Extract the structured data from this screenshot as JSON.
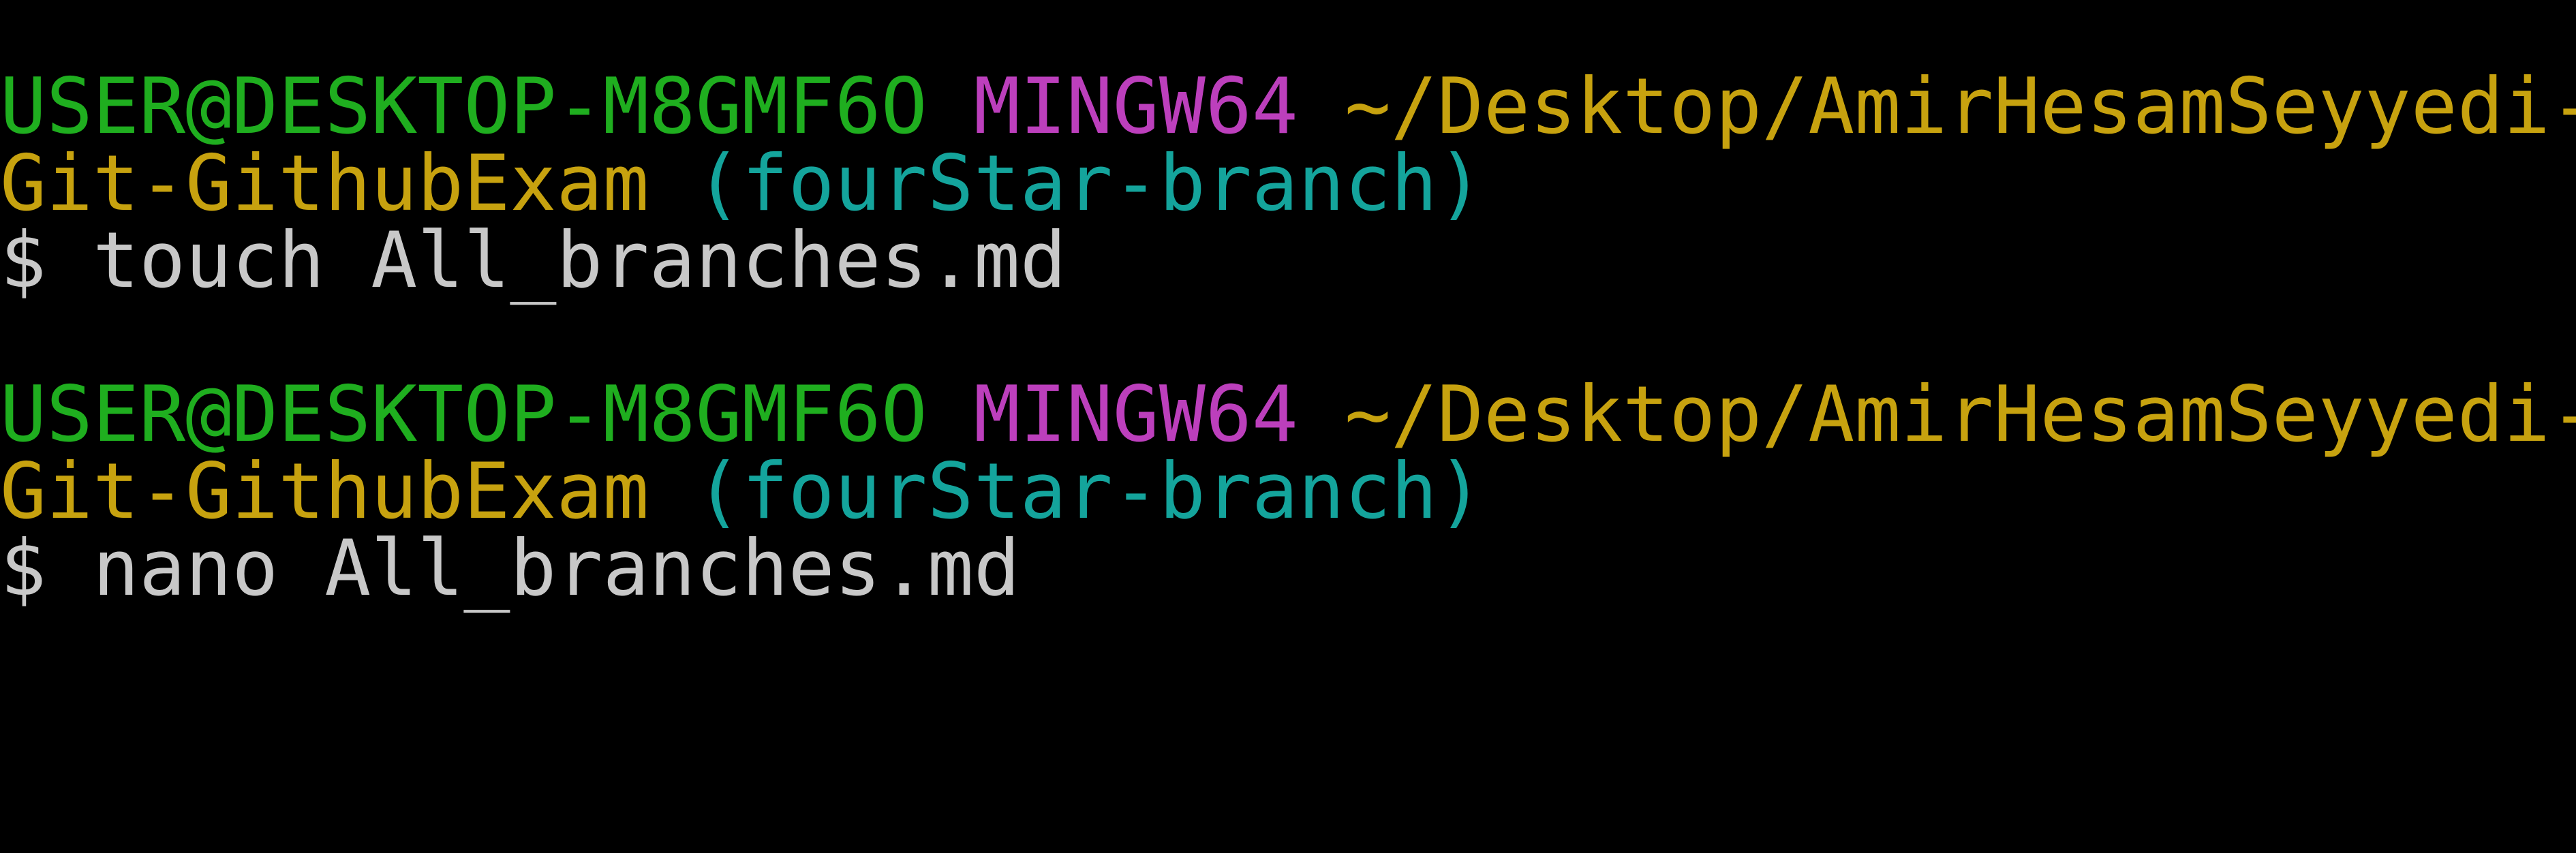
{
  "colors": {
    "background": "#000000",
    "user_host": "#1fae1f",
    "msystem": "#bc3fbc",
    "path": "#c7a20f",
    "branch": "#14a49c",
    "command": "#c8c8c8"
  },
  "blocks": [
    {
      "user_host": "USER@DESKTOP-M8GMF6O",
      "msystem": "MINGW64",
      "path_part1": "~/Desktop/AmirHesamSeyyedi-",
      "path_part2": "Git-GithubExam",
      "branch": "(fourStar-branch)",
      "prompt_symbol": "$",
      "command": "touch All_branches.md"
    },
    {
      "user_host": "USER@DESKTOP-M8GMF6O",
      "msystem": "MINGW64",
      "path_part1": "~/Desktop/AmirHesamSeyyedi-",
      "path_part2": "Git-GithubExam",
      "branch": "(fourStar-branch)",
      "prompt_symbol": "$",
      "command": "nano All_branches.md"
    }
  ]
}
